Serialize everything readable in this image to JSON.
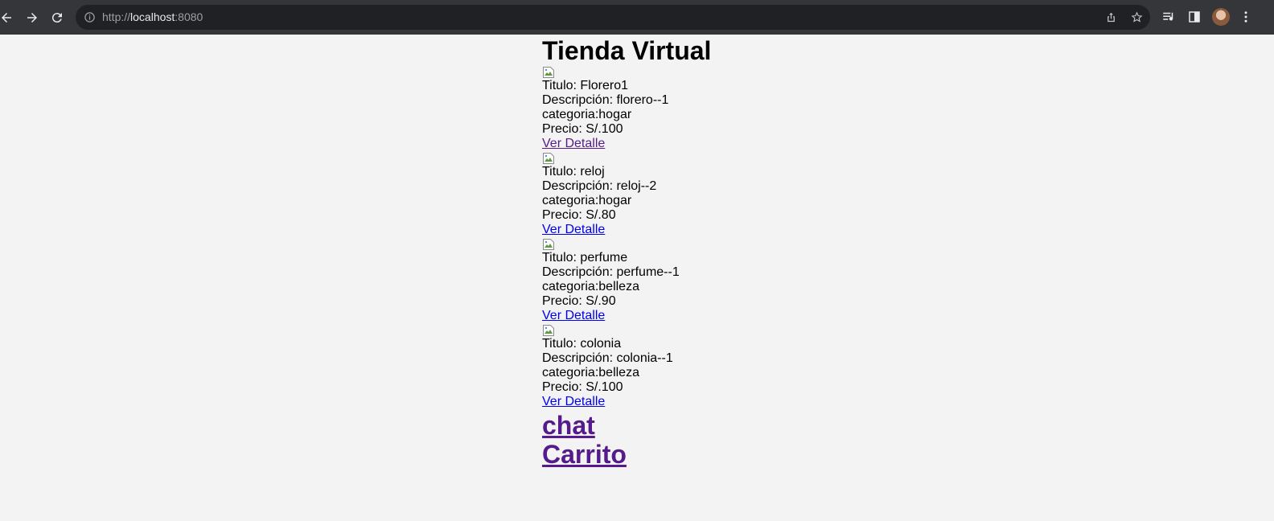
{
  "browser": {
    "url_scheme": "http://",
    "url_host": "localhost",
    "url_port": ":8080"
  },
  "page": {
    "title": "Tienda Virtual",
    "products": [
      {
        "titulo": "Titulo: Florero1",
        "descripcion": "Descripción: florero--1",
        "categoria": "categoria:hogar",
        "precio": "Precio: S/.100",
        "link": "Ver Detalle",
        "visited": true
      },
      {
        "titulo": "Titulo: reloj",
        "descripcion": "Descripción: reloj--2",
        "categoria": "categoria:hogar",
        "precio": "Precio: S/.80",
        "link": "Ver Detalle",
        "visited": false
      },
      {
        "titulo": "Titulo: perfume",
        "descripcion": "Descripción: perfume--1",
        "categoria": "categoria:belleza",
        "precio": "Precio: S/.90",
        "link": "Ver Detalle",
        "visited": false
      },
      {
        "titulo": "Titulo: colonia",
        "descripcion": "Descripción: colonia--1",
        "categoria": "categoria:belleza",
        "precio": "Precio: S/.100",
        "link": "Ver Detalle",
        "visited": false
      }
    ],
    "chat_link": "chat",
    "cart_link": "Carrito"
  },
  "colors": {
    "link": "#0000ee",
    "visited": "#551a8b",
    "background": "#f3f3f3",
    "toolbar": "#35363a"
  }
}
